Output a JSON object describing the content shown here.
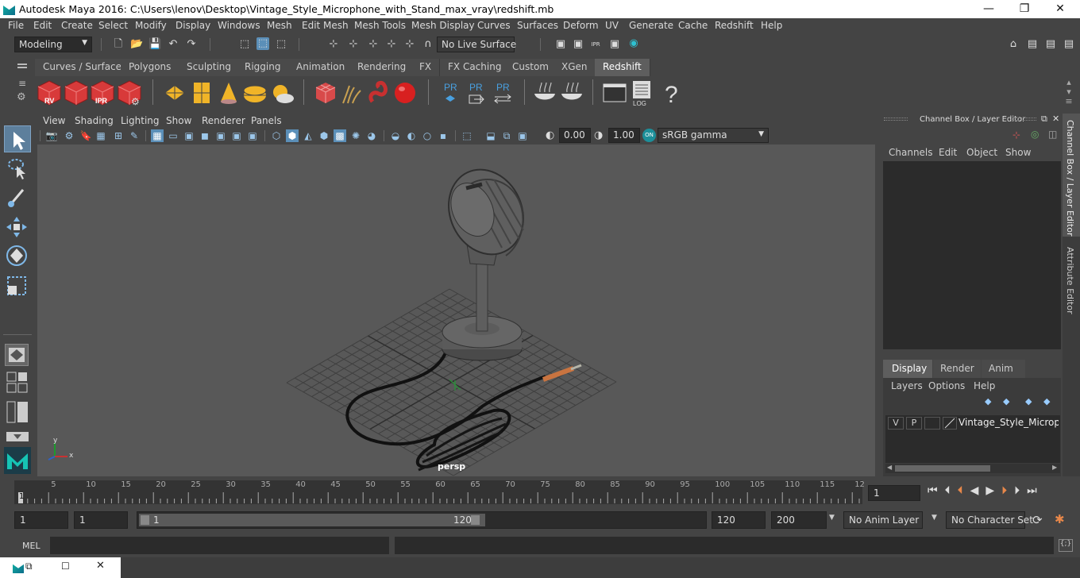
{
  "window": {
    "title": "Autodesk Maya 2016: C:\\Users\\lenov\\Desktop\\Vintage_Style_Microphone_with_Stand_max_vray\\redshift.mb",
    "minimize": "—",
    "maximize": "❐",
    "close": "✕"
  },
  "menus": [
    "File",
    "Edit",
    "Create",
    "Select",
    "Modify",
    "Display",
    "Windows",
    "Mesh",
    "Edit Mesh",
    "Mesh Tools",
    "Mesh Display",
    "Curves",
    "Surfaces",
    "Deform",
    "UV",
    "Generate",
    "Cache",
    "Redshift",
    "Help"
  ],
  "status": {
    "mode": "Modeling",
    "live_surface": "No Live Surface"
  },
  "shelf_tabs": [
    "Curves / Surfaces",
    "Polygons",
    "Sculpting",
    "Rigging",
    "Animation",
    "Rendering",
    "FX",
    "FX Caching",
    "Custom",
    "XGen",
    "Redshift"
  ],
  "shelf_active": "Redshift",
  "shelf_icons": [
    {
      "name": "rv",
      "label": "RV",
      "color": "#d83a3a"
    },
    {
      "name": "clapper",
      "label": "",
      "color": "#d83a3a"
    },
    {
      "name": "ipr",
      "label": "IPR",
      "color": "#d83a3a"
    },
    {
      "name": "render-settings",
      "label": "",
      "color": "#d83a3a"
    },
    {
      "name": "light-rect",
      "label": "",
      "color": "#f0b428"
    },
    {
      "name": "light-portal",
      "label": "",
      "color": "#f0b428"
    },
    {
      "name": "light-spot",
      "label": "",
      "color": "#f0b428"
    },
    {
      "name": "light-dome",
      "label": "",
      "color": "#f0b428"
    },
    {
      "name": "sun",
      "label": "",
      "color": "#f0b428"
    },
    {
      "name": "proxy-cube",
      "label": "",
      "color": "#d84a4a"
    },
    {
      "name": "hair",
      "label": "",
      "color": "#c8a050"
    },
    {
      "name": "volume",
      "label": "",
      "color": "#c83030"
    },
    {
      "name": "sphere",
      "label": "",
      "color": "#d82020"
    },
    {
      "name": "pr-export",
      "label": "PR",
      "color": "#49a0e0"
    },
    {
      "name": "pr-import",
      "label": "PR",
      "color": "#49a0e0"
    },
    {
      "name": "pr-swap",
      "label": "PR",
      "color": "#49a0e0"
    },
    {
      "name": "bowl",
      "label": "",
      "color": "#ddd"
    },
    {
      "name": "bowl-2",
      "label": "",
      "color": "#ddd"
    },
    {
      "name": "code",
      "label": "</>",
      "color": "#ddd"
    },
    {
      "name": "log",
      "label": "LOG",
      "color": "#ddd"
    },
    {
      "name": "help",
      "label": "?",
      "color": "#ddd"
    }
  ],
  "viewport": {
    "menus": [
      "View",
      "Shading",
      "Lighting",
      "Show",
      "Renderer",
      "Panels"
    ],
    "exposure": "0.00",
    "gamma": "1.00",
    "color_space": "sRGB gamma",
    "camera": "persp",
    "axis_x": "x",
    "axis_y": "y"
  },
  "channel_box": {
    "title": "Channel Box / Layer Editor",
    "menus": [
      "Channels",
      "Edit",
      "Object",
      "Show"
    ]
  },
  "layer_editor": {
    "tabs": [
      "Display",
      "Render",
      "Anim"
    ],
    "active_tab": "Display",
    "menus": [
      "Layers",
      "Options",
      "Help"
    ],
    "layer": {
      "v": "V",
      "p": "P",
      "name": "Vintage_Style_Micropho"
    }
  },
  "side_tabs": [
    "Channel Box / Layer Editor",
    "Attribute Editor"
  ],
  "timeline": {
    "ticks": [
      "5",
      "10",
      "15",
      "20",
      "25",
      "30",
      "35",
      "40",
      "45",
      "50",
      "55",
      "60",
      "65",
      "70",
      "75",
      "80",
      "85",
      "90",
      "95",
      "100",
      "105",
      "110",
      "115",
      "12"
    ],
    "start_label": "1",
    "current_frame": "1"
  },
  "range": {
    "start": "1",
    "start2": "1",
    "slider_start": "1",
    "slider_end": "120",
    "end": "120",
    "end2": "200",
    "anim_layer": "No Anim Layer",
    "char_set": "No Character Set"
  },
  "mel": {
    "label": "MEL"
  }
}
